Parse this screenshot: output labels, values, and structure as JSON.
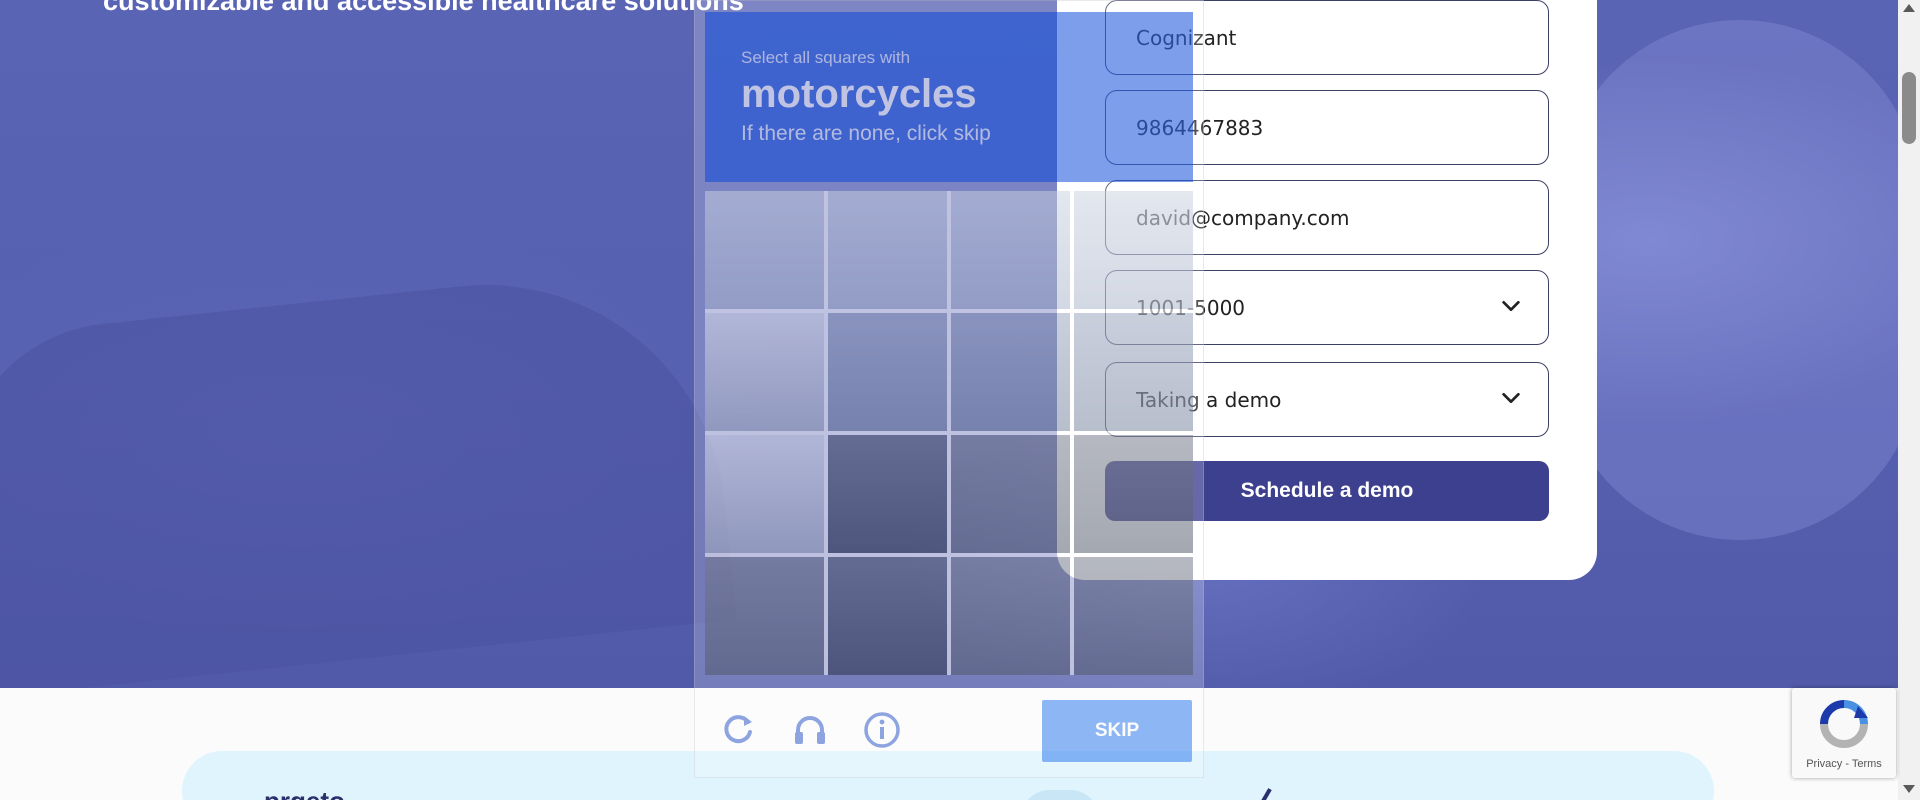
{
  "hero": {
    "heading": "customizable and accessible healthcare solutions"
  },
  "form": {
    "company_value": "Cognizant",
    "phone_value": "9864467883",
    "email_value": "david@company.com",
    "company_size_selected": "1001-5000",
    "interest_selected": "Taking a demo",
    "submit_label": "Schedule a demo"
  },
  "captcha": {
    "instruction": "Select all squares with",
    "target": "motorcycles",
    "hint": "If there are none, click skip",
    "skip_label": "SKIP",
    "icons": [
      "reload-icon",
      "audio-icon",
      "info-icon"
    ]
  },
  "promo": {
    "partial_text": "prgeto"
  },
  "recaptcha_badge": {
    "links": "Privacy - Terms"
  },
  "colors": {
    "hero_overlay": "#5660b0",
    "submit_button": "#3d3f8f",
    "captcha_accent": "#2f64e0",
    "promo_card": "#dff4fd"
  }
}
